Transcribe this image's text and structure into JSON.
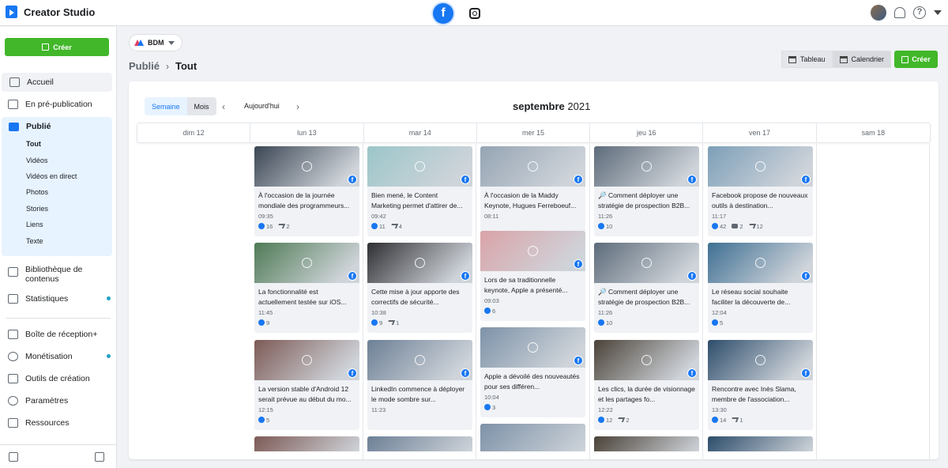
{
  "app": {
    "title": "Creator Studio"
  },
  "topbar": {
    "platforms": [
      "facebook-icon",
      "instagram-icon"
    ],
    "fb_glyph": "f"
  },
  "sidebar": {
    "create_label": "Créer",
    "home": "Accueil",
    "prepub": "En pré-publication",
    "publie": "Publié",
    "publie_sub": [
      "Tout",
      "Vidéos",
      "Vidéos en direct",
      "Photos",
      "Stories",
      "Liens",
      "Texte"
    ],
    "library": "Bibliothèque de contenus",
    "stats": "Statistiques",
    "inbox": "Boîte de réception+",
    "monet": "Monétisation",
    "tools": "Outils de création",
    "settings": "Paramètres",
    "resources": "Ressources"
  },
  "header": {
    "page_selector": "BDM",
    "breadcrumb": [
      "Publié",
      "Tout"
    ],
    "view_table": "Tableau",
    "view_calendar": "Calendrier",
    "create_label": "Créer"
  },
  "calendar": {
    "mode_week": "Semaine",
    "mode_month": "Mois",
    "prev": "‹",
    "next": "›",
    "today": "Aujourd'hui",
    "month_name": "septembre",
    "year": "2021",
    "days": [
      "dim 12",
      "lun 13",
      "mar 14",
      "mer 15",
      "jeu 16",
      "ven 17",
      "sam 18"
    ]
  },
  "posts": {
    "lun": [
      {
        "text": "À l'occasion de la journée mondiale des programmeurs...",
        "time": "09:35",
        "likes": "16",
        "shares": "2",
        "color": "#3b4654"
      },
      {
        "text": "La fonctionnalité est actuellement testée sur iOS...",
        "time": "11:45",
        "likes": "9",
        "shares": "",
        "color": "#4f7a55"
      },
      {
        "text": "La version stable d'Android 12 serait prévue au début du mo...",
        "time": "12:15",
        "likes": "5",
        "shares": "",
        "color": "#7d5a56"
      }
    ],
    "mar": [
      {
        "text": "Bien mené, le Content Marketing permet d'attirer de...",
        "time": "09:42",
        "likes": "11",
        "shares": "4",
        "color": "#9bc6c9"
      },
      {
        "text": "Cette mise à jour apporte des correctifs de sécurité...",
        "time": "10:38",
        "likes": "9",
        "shares": "1",
        "color": "#2f2f33"
      },
      {
        "text": "LinkedIn commence à déployer le mode sombre sur...",
        "time": "11:23",
        "likes": "",
        "shares": "",
        "color": "#6d8096"
      }
    ],
    "mer": [
      {
        "text": "À l'occasion de la Maddy Keynote, Hugues Ferreboeuf...",
        "time": "08:11",
        "likes": "",
        "shares": "",
        "color": "#95a4b3"
      },
      {
        "text": "Lors de sa traditionnelle keynote, Apple a présenté...",
        "time": "09:03",
        "likes": "6",
        "shares": "",
        "color": "#d9a3a8"
      },
      {
        "text": "Apple a dévoilé des nouveautés pour ses différen...",
        "time": "10:04",
        "likes": "3",
        "shares": "",
        "color": "#7d92a8"
      }
    ],
    "jeu": [
      {
        "text": "🔎 Comment déployer une stratégie de prospection B2B...",
        "time": "11:26",
        "likes": "10",
        "shares": "",
        "color": "#5d6b7a"
      },
      {
        "text": "🔎 Comment déployer une stratégie de prospection B2B...",
        "time": "11:26",
        "likes": "10",
        "shares": "",
        "color": "#5d6b7a"
      },
      {
        "text": "Les clics, la durée de visionnage et les partages fo...",
        "time": "12:22",
        "likes": "12",
        "shares": "2",
        "color": "#4a4238"
      }
    ],
    "ven": [
      {
        "text": "Facebook propose de nouveaux outils à destination...",
        "time": "11:17",
        "likes": "42",
        "comments": "2",
        "shares": "12",
        "color": "#7d9fb8"
      },
      {
        "text": "Le réseau social souhaite faciliter la découverte de...",
        "time": "12:04",
        "likes": "5",
        "shares": "",
        "color": "#3e6f93"
      },
      {
        "text": "Rencontre avec Inès Slama, membre de l'association...",
        "time": "13:30",
        "likes": "14",
        "shares": "1",
        "color": "#2d4d6b"
      }
    ]
  }
}
